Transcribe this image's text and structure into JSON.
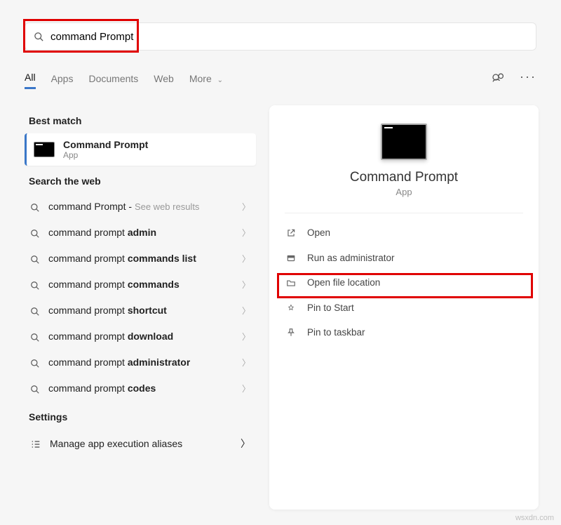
{
  "search": {
    "value": "command Prompt"
  },
  "tabs": {
    "all": "All",
    "apps": "Apps",
    "documents": "Documents",
    "web": "Web",
    "more": "More"
  },
  "sections": {
    "best": "Best match",
    "web": "Search the web",
    "settings": "Settings"
  },
  "bestMatch": {
    "title": "Command Prompt",
    "subtitle": "App"
  },
  "webResults": [
    {
      "prefix": "command Prompt",
      "bold": "",
      "hint": "See web results"
    },
    {
      "prefix": "command prompt ",
      "bold": "admin",
      "hint": ""
    },
    {
      "prefix": "command prompt ",
      "bold": "commands list",
      "hint": ""
    },
    {
      "prefix": "command prompt ",
      "bold": "commands",
      "hint": ""
    },
    {
      "prefix": "command prompt ",
      "bold": "shortcut",
      "hint": ""
    },
    {
      "prefix": "command prompt ",
      "bold": "download",
      "hint": ""
    },
    {
      "prefix": "command prompt ",
      "bold": "administrator",
      "hint": ""
    },
    {
      "prefix": "command prompt ",
      "bold": "codes",
      "hint": ""
    }
  ],
  "settingsItem": "Manage app execution aliases",
  "preview": {
    "title": "Command Prompt",
    "subtitle": "App"
  },
  "actions": {
    "open": "Open",
    "runAdmin": "Run as administrator",
    "openLocation": "Open file location",
    "pinStart": "Pin to Start",
    "pinTaskbar": "Pin to taskbar"
  },
  "watermark": "wsxdn.com"
}
